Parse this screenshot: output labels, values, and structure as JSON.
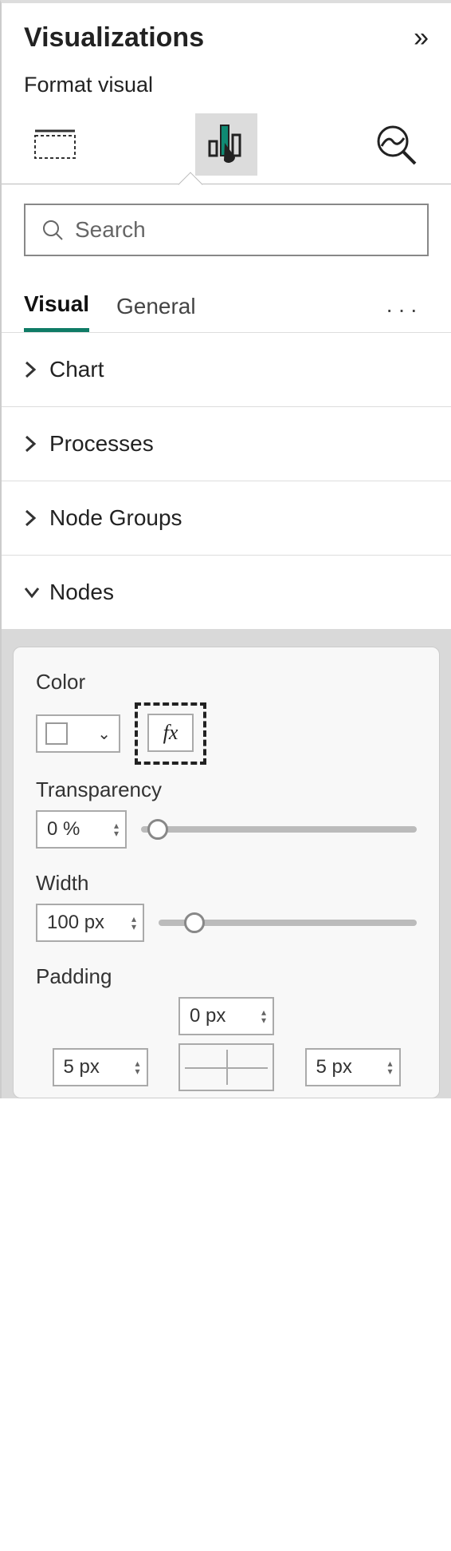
{
  "panel": {
    "title": "Visualizations",
    "subtitle": "Format visual"
  },
  "search": {
    "placeholder": "Search"
  },
  "tabs": {
    "visual": "Visual",
    "general": "General"
  },
  "sections": {
    "chart": "Chart",
    "processes": "Processes",
    "nodeGroups": "Node Groups",
    "nodes": "Nodes"
  },
  "nodes": {
    "colorLabel": "Color",
    "fxLabel": "fx",
    "transparencyLabel": "Transparency",
    "transparencyValue": "0 %",
    "widthLabel": "Width",
    "widthValue": "100 px",
    "paddingLabel": "Padding",
    "padTop": "0 px",
    "padLeft": "5 px",
    "padRight": "5 px"
  }
}
